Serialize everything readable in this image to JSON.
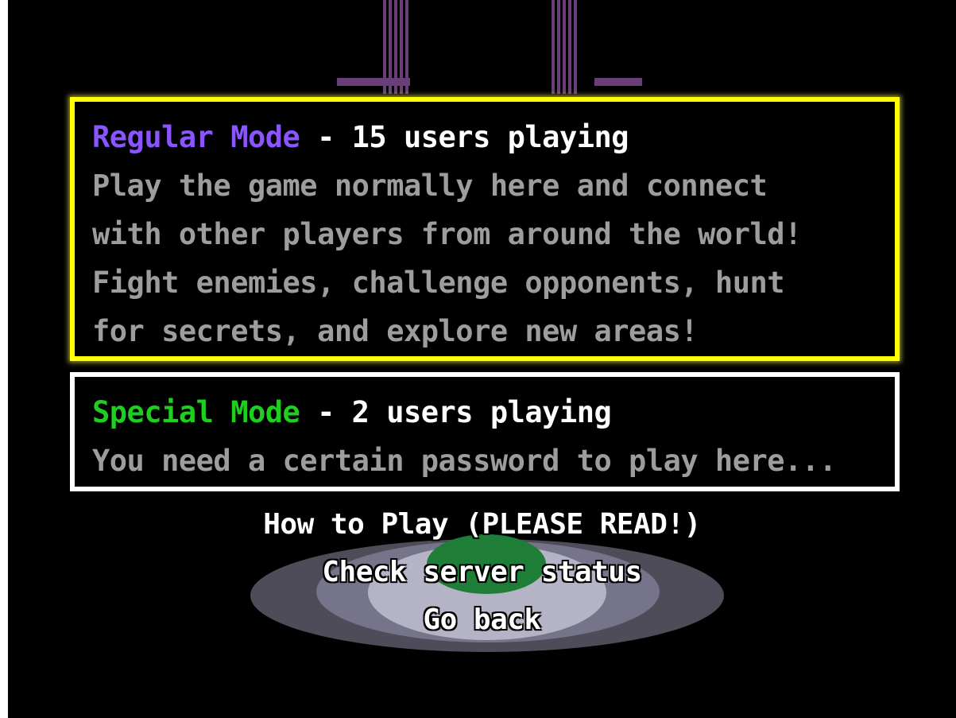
{
  "regular_mode": {
    "name": "Regular Mode",
    "separator": " - ",
    "status": "15 users playing",
    "description_lines": [
      "Play the game normally here and connect",
      "with other players from around the world!",
      "Fight enemies, challenge opponents, hunt",
      "for secrets, and explore new areas!"
    ],
    "border_color": "#ffff00",
    "name_color": "#8a55ff"
  },
  "special_mode": {
    "name": "Special Mode",
    "separator": " - ",
    "status": "2 users playing",
    "description_lines": [
      "You need a certain password to play here..."
    ],
    "border_color": "#ffffff",
    "name_color": "#1ecf1e"
  },
  "menu": {
    "how_to_play": "How to Play (PLEASE READ!)",
    "check_status": "Check server status",
    "go_back": "Go back"
  }
}
